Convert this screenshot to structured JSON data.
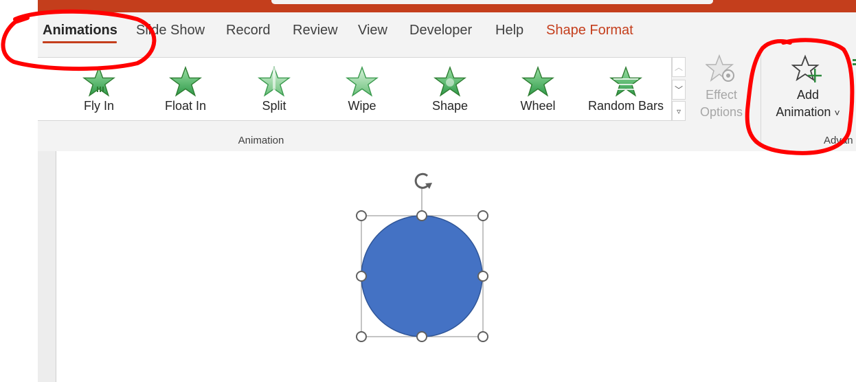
{
  "tabs": [
    {
      "label": "Animations",
      "active": true
    },
    {
      "label": "Slide Show"
    },
    {
      "label": "Record"
    },
    {
      "label": "Review"
    },
    {
      "label": "View"
    },
    {
      "label": "Developer"
    },
    {
      "label": "Help"
    },
    {
      "label": "Shape Format",
      "contextual": true
    }
  ],
  "gallery": {
    "items": [
      {
        "label": "Fly In",
        "icon": "fly-in-star-icon"
      },
      {
        "label": "Float In",
        "icon": "float-in-star-icon"
      },
      {
        "label": "Split",
        "icon": "split-star-icon"
      },
      {
        "label": "Wipe",
        "icon": "wipe-star-icon"
      },
      {
        "label": "Shape",
        "icon": "shape-star-icon"
      },
      {
        "label": "Wheel",
        "icon": "wheel-star-icon"
      },
      {
        "label": "Random Bars",
        "icon": "random-bars-star-icon"
      }
    ],
    "group_label": "Animation"
  },
  "effect_options": {
    "line1": "Effect",
    "line2": "Options",
    "enabled": false
  },
  "add_animation": {
    "line1": "Add",
    "line2": "Animation",
    "dropdown_glyph": "˅"
  },
  "advanced_group_label": "Advan",
  "colors": {
    "accent": "#c43e1c",
    "ribbon_bg": "#f3f3f3",
    "star_green": "#3aa655",
    "shape_fill": "#4472c4",
    "annotation_red": "#ff0000"
  }
}
